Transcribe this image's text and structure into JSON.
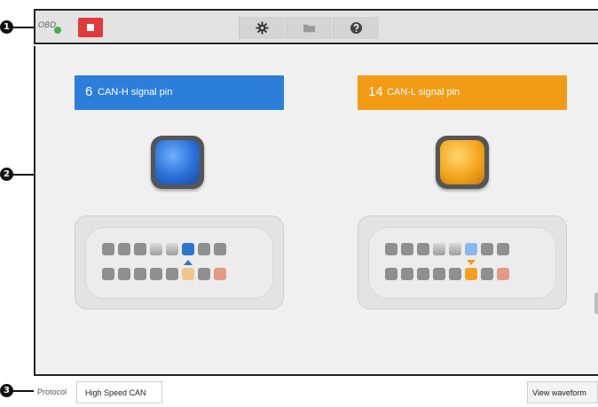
{
  "callouts": [
    "1",
    "2",
    "3"
  ],
  "toolbar": {
    "obd_label": "OBD",
    "icons": [
      "stop-icon",
      "gear-icon",
      "folder-icon",
      "help-icon"
    ]
  },
  "pins": {
    "high": {
      "number": "6",
      "label": "CAN-H signal pin",
      "color": "#2b7fdb"
    },
    "low": {
      "number": "14",
      "label": "CAN-L signal pin",
      "color": "#f29c16"
    }
  },
  "footer": {
    "protocol_label": "Protocol",
    "protocol_value": "High Speed CAN",
    "view_waveform_label": "View waveform"
  }
}
